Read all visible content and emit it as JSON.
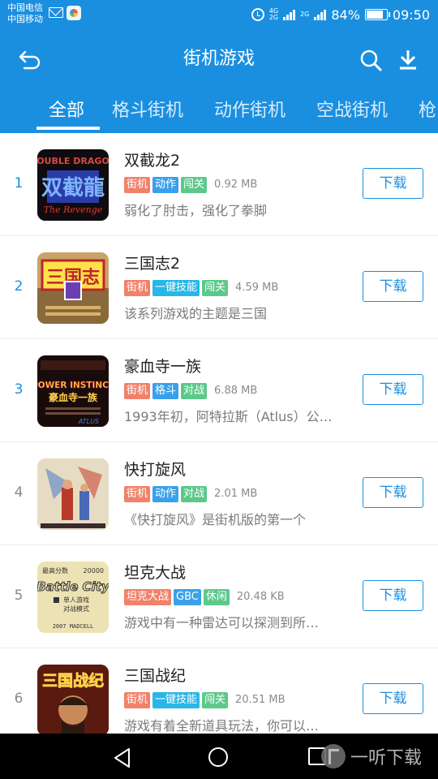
{
  "status_bar": {
    "carrier_1": "中国电信",
    "carrier_2": "中国移动",
    "net_1": "4G",
    "net_2": "2G",
    "net_3": "2G",
    "battery": "84%",
    "time": "09:50"
  },
  "header": {
    "title": "街机游戏",
    "back_icon": "back-arrow-icon",
    "search_icon": "search-icon",
    "download_icon": "download-icon"
  },
  "tabs": [
    "全部",
    "格斗街机",
    "动作街机",
    "空战街机",
    "枪"
  ],
  "active_tab": "全部",
  "colors": {
    "primary": "#1a8fe0",
    "tag_orange": "#f0826a",
    "tag_blue": "#3aa0ea",
    "tag_green": "#5cc98a",
    "tag_cyan": "#29b7e6"
  },
  "games": [
    {
      "rank": "1",
      "title": "双截龙2",
      "tags": [
        "街机",
        "动作",
        "闯关"
      ],
      "size": "0.92 MB",
      "desc": "弱化了肘击，强化了拳脚",
      "button": "下载",
      "art_text": "DOUBLE DRAGON"
    },
    {
      "rank": "2",
      "title": "三国志2",
      "tags": [
        "街机",
        "一键技能",
        "闯关"
      ],
      "size": "4.59 MB",
      "desc": "该系列游戏的主题是三国",
      "button": "下载",
      "art_text": "三国志"
    },
    {
      "rank": "3",
      "title": "豪血寺一族",
      "tags": [
        "街机",
        "格斗",
        "对战"
      ],
      "size": "6.88 MB",
      "desc": "1993年初，阿特拉斯（Atlus）公…",
      "button": "下载",
      "art_text": "POWER INSTINCT"
    },
    {
      "rank": "4",
      "title": "快打旋风",
      "tags": [
        "街机",
        "动作",
        "对战"
      ],
      "size": "2.01 MB",
      "desc": "《快打旋风》是街机版的第一个",
      "button": "下载",
      "art_text": ""
    },
    {
      "rank": "5",
      "title": "坦克大战",
      "tags": [
        "坦克大战",
        "GBC",
        "休闲"
      ],
      "size": "20.48 KB",
      "desc": " 游戏中有一种雷达可以探测到所…",
      "button": "下载",
      "art_text": "Battle City",
      "art_top_left": "最高分数",
      "art_top_right": "20000",
      "art_line1": "单人游戏",
      "art_line2": "对战模式",
      "art_footer": "2007  MADCELL"
    },
    {
      "rank": "6",
      "title": "三国战纪",
      "tags": [
        "街机",
        "一键技能",
        "闯关"
      ],
      "size": "20.51 MB",
      "desc": " 游戏有着全新道具玩法，你可以…",
      "button": "下载",
      "art_text": "三国战纪"
    }
  ],
  "watermark": "一听下载"
}
